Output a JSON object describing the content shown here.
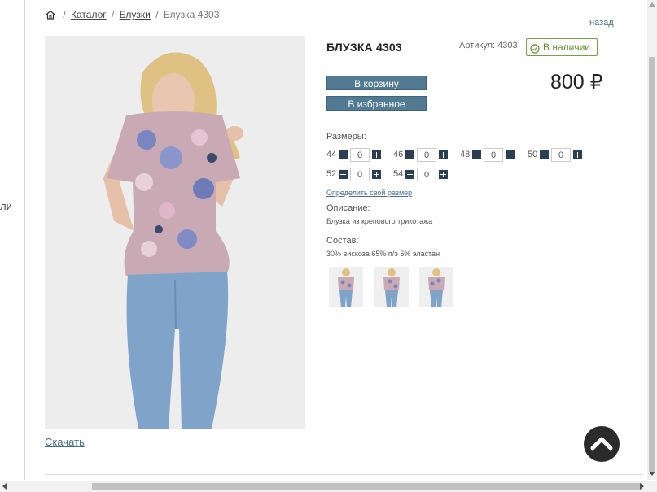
{
  "left_partial_text": "ли",
  "breadcrumb": {
    "items": [
      "Каталог",
      "Блузки",
      "Блузка 4303"
    ],
    "separator": "/"
  },
  "back_link": "назад",
  "product": {
    "title": "БЛУЗКА 4303",
    "article": "Артикул: 4303",
    "stock": "В наличии",
    "price": "800 ₽",
    "add_to_cart": "В корзину",
    "add_to_favorites": "В избранное",
    "sizes_label": "Размеры:",
    "sizes": [
      {
        "size": "44",
        "qty": "0"
      },
      {
        "size": "46",
        "qty": "0"
      },
      {
        "size": "48",
        "qty": "0"
      },
      {
        "size": "50",
        "qty": "0"
      },
      {
        "size": "52",
        "qty": "0"
      },
      {
        "size": "54",
        "qty": "0"
      }
    ],
    "size_link": "Определить свой размер",
    "description_label": "Описание:",
    "description": "Блузка из крепового трикотажа",
    "composition_label": "Состав:",
    "composition": "30% вискоза 65% п/э 5% эластан"
  },
  "download_link": "Скачать",
  "colors": {
    "button": "#527a92",
    "stock_green": "#5e8f2b",
    "link": "#4a6f8a",
    "blouse": "#c9a9b4",
    "jeans": "#7fa3c9"
  },
  "icons": [
    "home-icon",
    "check-circle-icon",
    "minus-icon",
    "plus-icon",
    "chevron-up-icon"
  ]
}
